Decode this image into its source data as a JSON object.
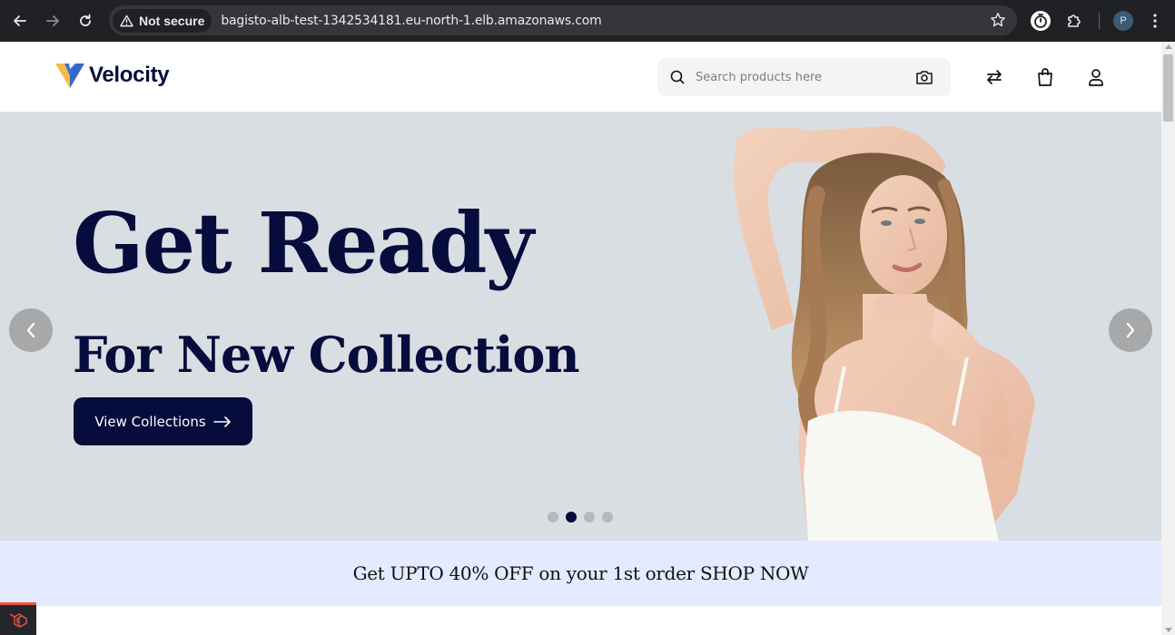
{
  "browser": {
    "security_label": "Not secure",
    "url": "bagisto-alb-test-1342534181.eu-north-1.elb.amazonaws.com",
    "profile_initial": "P"
  },
  "header": {
    "logo_text": "Velocity",
    "search_placeholder": "Search products here"
  },
  "hero": {
    "title": "Get Ready",
    "subtitle": "For New Collection",
    "button_label": "View Collections",
    "slide_count": 4,
    "active_slide": 2
  },
  "promo": {
    "text": "Get UPTO 40% OFF on your 1st order SHOP NOW"
  },
  "colors": {
    "brand_navy": "#060c3b",
    "hero_bg": "#d9dee3",
    "promo_bg": "#e4eaff",
    "logo_orange": "#f5a623",
    "logo_blue": "#1e63d6"
  }
}
